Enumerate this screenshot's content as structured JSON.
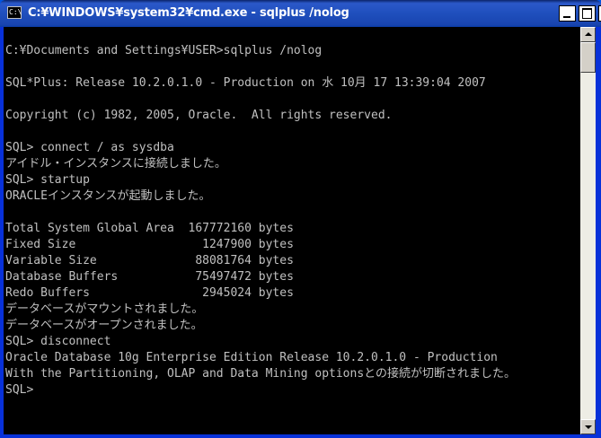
{
  "window": {
    "title": "C:¥WINDOWS¥system32¥cmd.exe - sqlplus /nolog",
    "icon_text": "C:\\",
    "controls": [
      "minimize-icon",
      "maximize-icon",
      "close-icon"
    ]
  },
  "console": {
    "lines": [
      "",
      "C:¥Documents and Settings¥USER>sqlplus /nolog",
      "",
      "SQL*Plus: Release 10.2.0.1.0 - Production on 水 10月 17 13:39:04 2007",
      "",
      "Copyright (c) 1982, 2005, Oracle.  All rights reserved.",
      "",
      "SQL> connect / as sysdba",
      "アイドル・インスタンスに接続しました。",
      "SQL> startup",
      "ORACLEインスタンスが起動しました。",
      "",
      "Total System Global Area  167772160 bytes",
      "Fixed Size                  1247900 bytes",
      "Variable Size              88081764 bytes",
      "Database Buffers           75497472 bytes",
      "Redo Buffers                2945024 bytes",
      "データベースがマウントされました。",
      "データベースがオープンされました。",
      "SQL> disconnect",
      "Oracle Database 10g Enterprise Edition Release 10.2.0.1.0 - Production",
      "With the Partitioning, OLAP and Data Mining optionsとの接続が切断されました。",
      "SQL>"
    ]
  }
}
